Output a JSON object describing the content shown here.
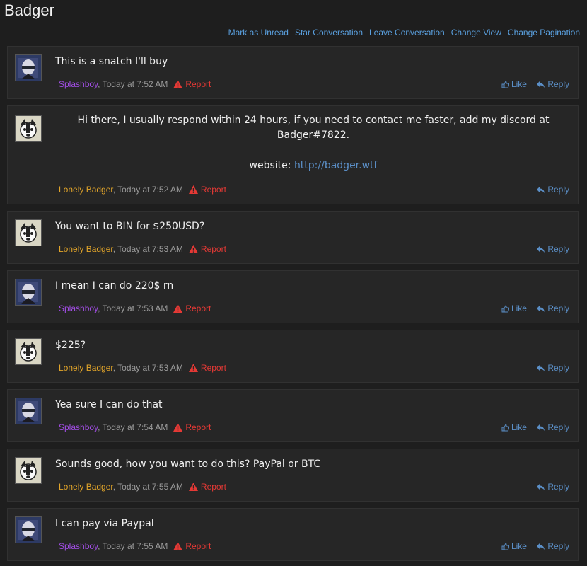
{
  "page": {
    "title": "Badger"
  },
  "actions": [
    "Mark as Unread",
    "Star Conversation",
    "Leave Conversation",
    "Change View",
    "Change Pagination"
  ],
  "labels": {
    "report": "Report",
    "like": "Like",
    "reply": "Reply"
  },
  "intro": {
    "author": "Lonely Badger",
    "time": ", Today at 7:52 AM",
    "line1": "Hi there, I usually respond within 24 hours, if you need to contact me faster, add my discord at",
    "line2": "Badger#7822.",
    "website_label": "website:",
    "website_url": "http://badger.wtf"
  },
  "messages": [
    {
      "author": "Splashboy",
      "time": ", Today at 7:52 AM",
      "text": "This is a snatch I'll buy"
    },
    {
      "author": "Lonely Badger",
      "time": ", Today at 7:53 AM",
      "text": "You want to BIN for $250USD?"
    },
    {
      "author": "Splashboy",
      "time": ", Today at 7:53 AM",
      "text": "I mean I can do 220$ rn"
    },
    {
      "author": "Lonely Badger",
      "time": ", Today at 7:53 AM",
      "text": "$225?"
    },
    {
      "author": "Splashboy",
      "time": ", Today at 7:54 AM",
      "text": "Yea sure I can do that"
    },
    {
      "author": "Lonely Badger",
      "time": ", Today at 7:55 AM",
      "text": "Sounds good, how you want to do this? PayPal or BTC"
    },
    {
      "author": "Splashboy",
      "time": ", Today at 7:55 AM",
      "text": "I can pay via Paypal"
    }
  ],
  "colors": {
    "link": "#5b8fc7",
    "report": "#e53935",
    "splashboy": "#a24ee6",
    "lonely_badger": "#e2a52a"
  }
}
